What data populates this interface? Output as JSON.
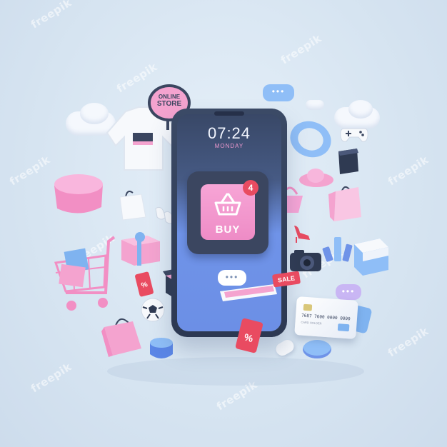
{
  "phone": {
    "time": "07:24",
    "day": "MONDAY",
    "buy_label": "BUY",
    "notification_count": "4"
  },
  "store_sign": {
    "line1": "ONLINE",
    "line2": "STORE"
  },
  "sale_tag": "SALE",
  "percent_tags": [
    "%",
    "%"
  ],
  "credit_card": {
    "number": "7687 7600 0000 0000",
    "holder": "CARD HOLDER"
  },
  "chat_bubble_text": "•••",
  "watermark": "freepik",
  "colors": {
    "background": "#d6e4f1",
    "phone_body": "#3b4660",
    "screen_blue": "#6f93e8",
    "accent_pink": "#f4a3cf",
    "alert_red": "#e94b61"
  }
}
